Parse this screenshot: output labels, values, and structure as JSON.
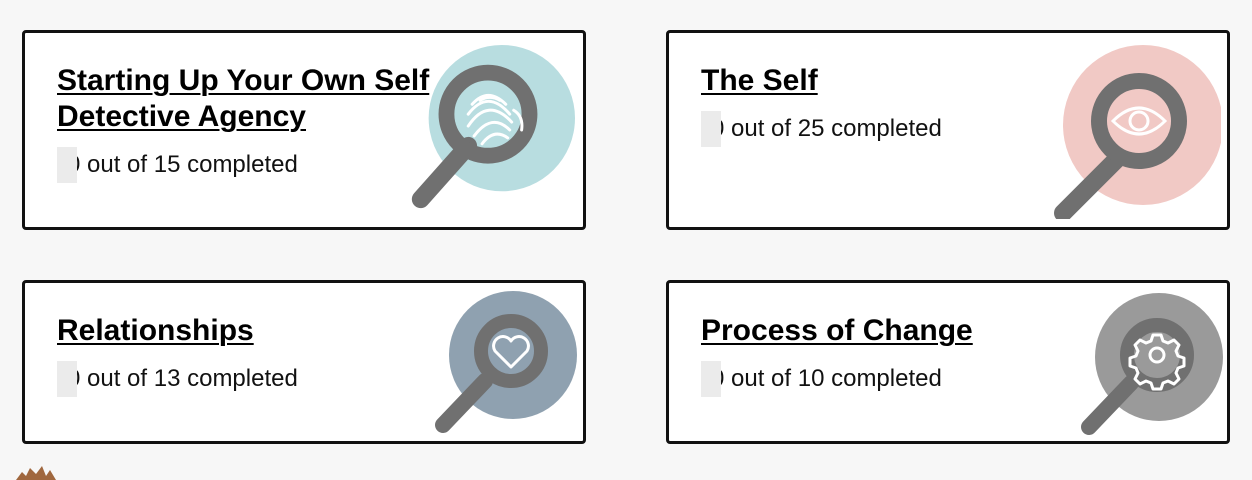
{
  "modules": [
    {
      "title": "Starting Up Your Own Self Detective Agency",
      "progress_text": "0 out of 15 completed",
      "completed": 0,
      "total": 15,
      "icon": "fingerprint-magnifier-icon",
      "circle_color": "#b8dde0"
    },
    {
      "title": "The Self",
      "progress_text": "0 out of 25 completed",
      "completed": 0,
      "total": 25,
      "icon": "eye-magnifier-icon",
      "circle_color": "#f1c9c5"
    },
    {
      "title": "Relationships",
      "progress_text": "0 out of 13 completed",
      "completed": 0,
      "total": 13,
      "icon": "heart-magnifier-icon",
      "circle_color": "#8fa1b0"
    },
    {
      "title": "Process of Change",
      "progress_text": "0 out of 10 completed",
      "completed": 0,
      "total": 10,
      "icon": "gear-magnifier-icon",
      "circle_color": "#9a9a9a"
    }
  ],
  "colors": {
    "magnifier": "#707070",
    "border": "#111111",
    "background": "#f7f7f7",
    "logo": "#a0673e"
  },
  "footer": {
    "logo_icon": "sun-logo-icon"
  }
}
